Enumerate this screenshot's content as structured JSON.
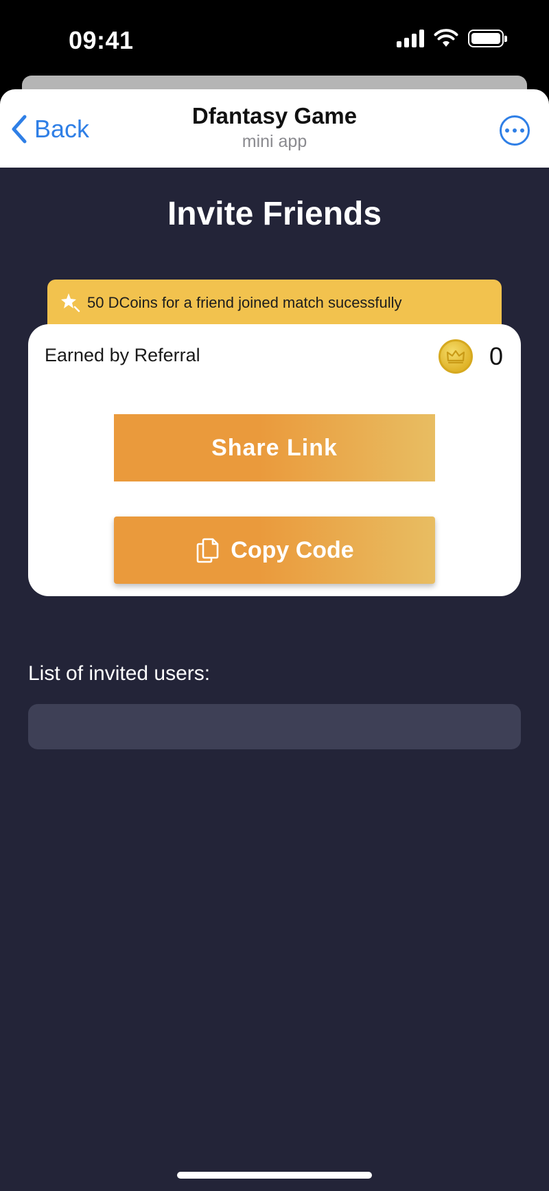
{
  "status_bar": {
    "time": "09:41"
  },
  "header": {
    "back_label": "Back",
    "title": "Dfantasy Game",
    "subtitle": "mini app"
  },
  "page": {
    "title": "Invite Friends"
  },
  "promo": {
    "text": "50 DCoins for a friend joined match sucessfully"
  },
  "referral": {
    "earned_label": "Earned by Referral",
    "earned_value": "0",
    "share_label": "Share Link",
    "copy_label": "Copy Code"
  },
  "invited": {
    "label": "List of invited users:"
  },
  "colors": {
    "accent_blue": "#2f7fe6",
    "background": "#232438",
    "banner": "#f2c24e",
    "button_orange": "#ea9a3c",
    "list_row": "#3e4056"
  },
  "icons": {
    "back": "chevron-left-icon",
    "more": "ellipsis-circle-icon",
    "promo": "sparkle-star-icon",
    "coin": "crown-coin-icon",
    "copy": "copy-icon"
  }
}
